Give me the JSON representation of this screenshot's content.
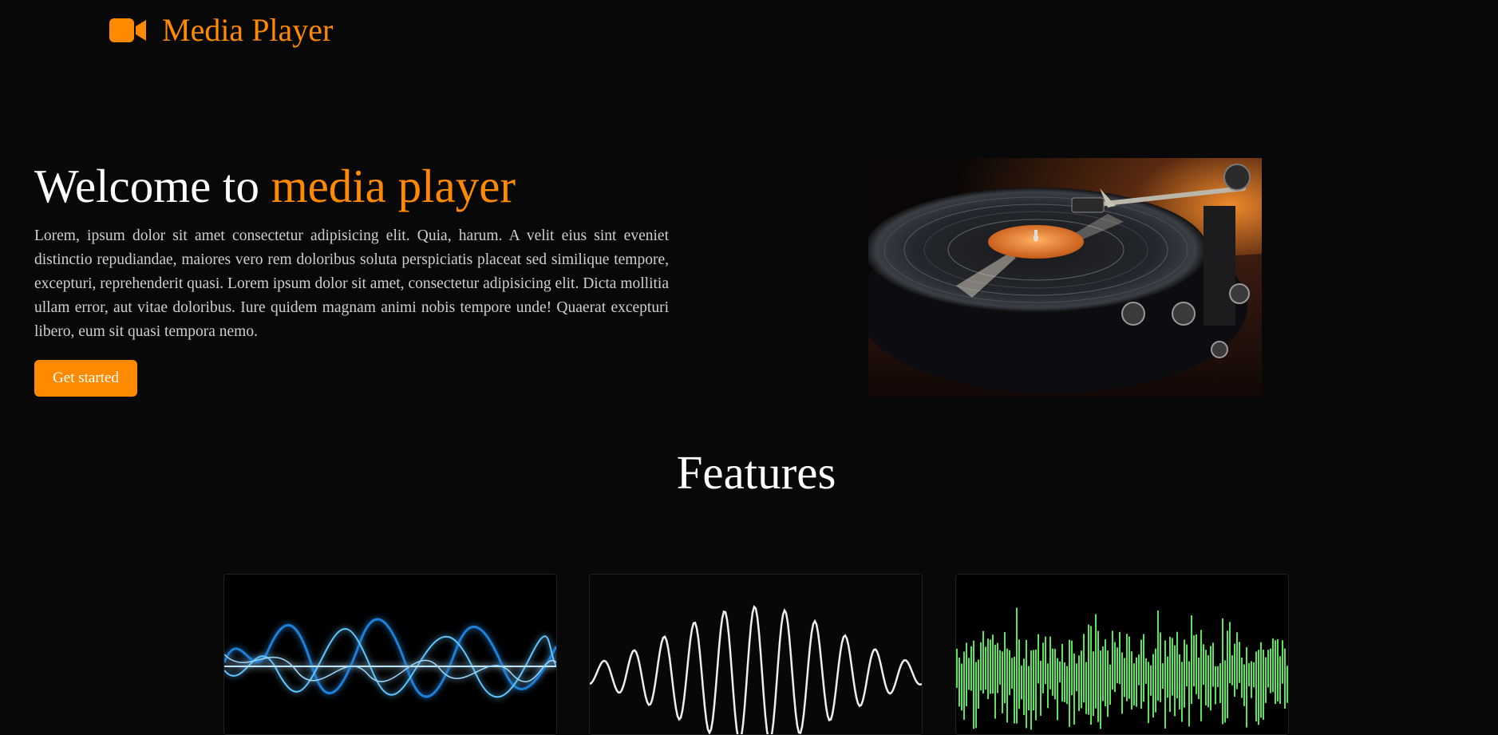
{
  "brand": {
    "name": "Media Player",
    "icon": "video-camera-icon",
    "accent_color": "#ff8a00"
  },
  "hero": {
    "title_prefix": "Welcome to ",
    "title_accent": "media player",
    "description": "Lorem, ipsum dolor sit amet consectetur adipisicing elit. Quia, harum. A velit eius sint eveniet distinctio repudiandae, maiores vero rem doloribus soluta perspiciatis placeat sed similique tempore, excepturi, reprehenderit quasi. Lorem ipsum dolor sit amet, consectetur adipisicing elit. Dicta mollitia ullam error, aut vitae doloribus. Iure quidem magnam animi nobis tempore unde! Quaerat excepturi libero, eum sit quasi tempora nemo.",
    "cta_label": "Get started",
    "image": "turntable-vinyl-record-image"
  },
  "features": {
    "title": "Features",
    "cards": [
      {
        "image": "blue-glowing-sound-wave-image",
        "color": "#29a8ff"
      },
      {
        "image": "white-sine-wave-image",
        "color": "#eeeeee"
      },
      {
        "image": "green-audio-waveform-image",
        "color": "#5be35b"
      }
    ]
  }
}
